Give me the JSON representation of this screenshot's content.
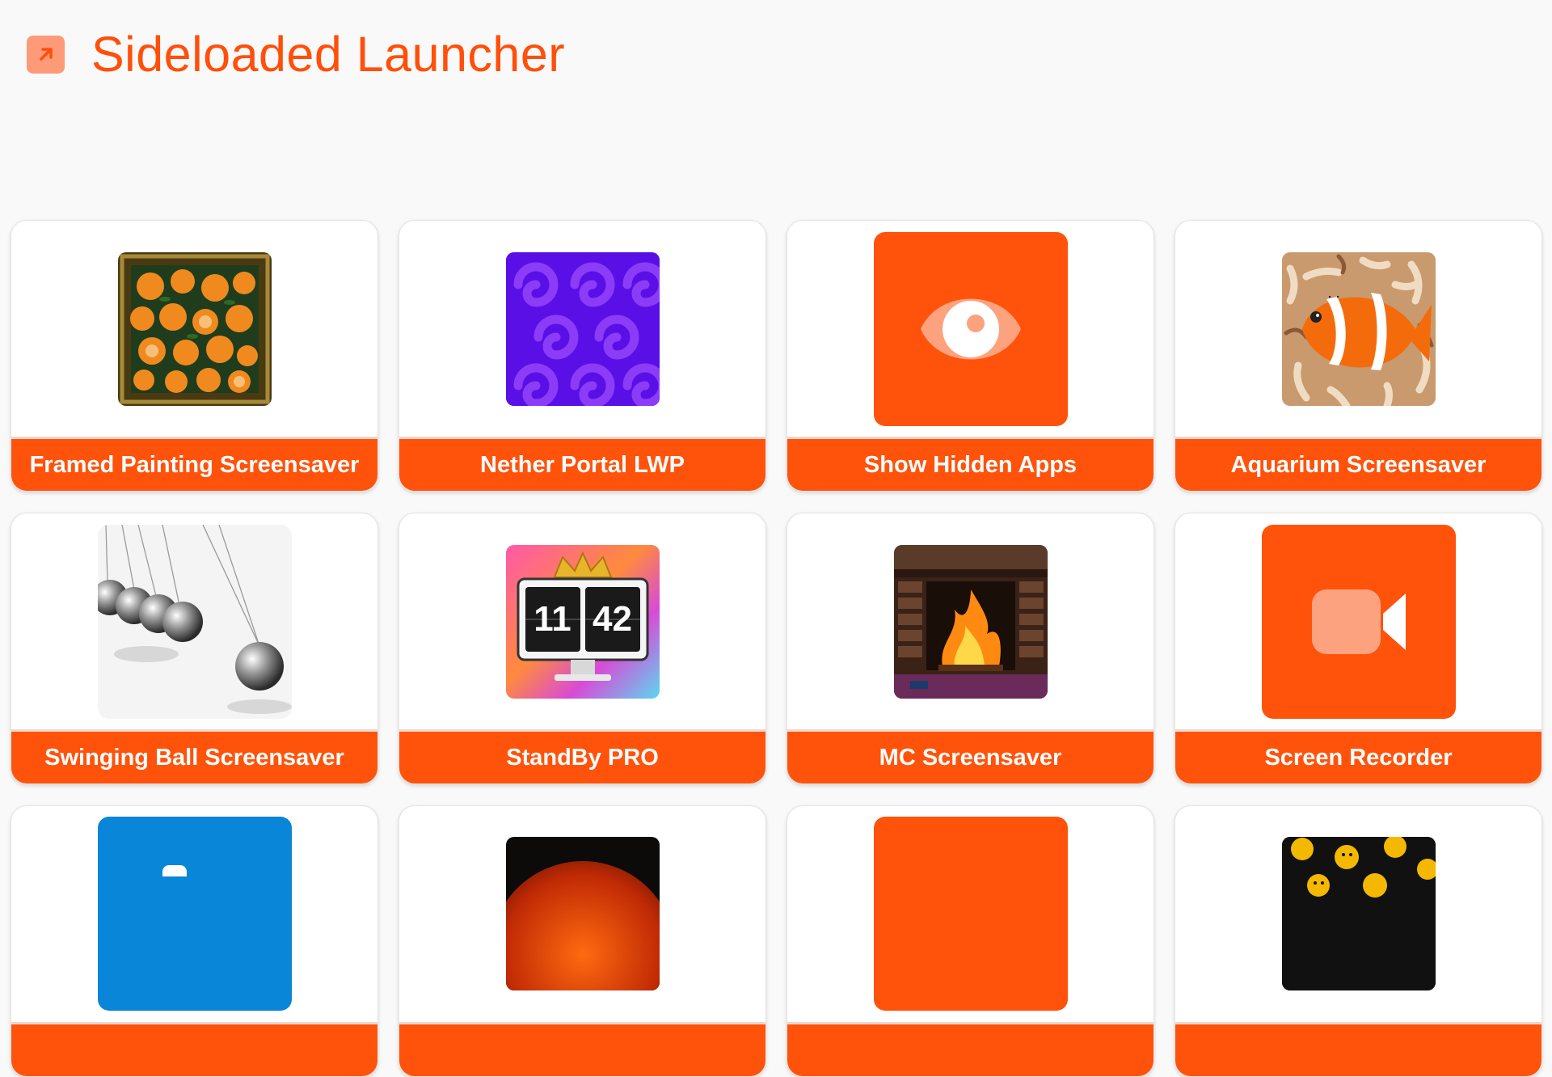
{
  "header": {
    "title": "Sideloaded Launcher",
    "logo_icon": "external-arrow-icon"
  },
  "colors": {
    "accent": "#ff530b",
    "accent_light": "#fda27f",
    "background": "#f9f9f9"
  },
  "apps": [
    {
      "label": "Framed Painting Screensaver",
      "icon": "framed-oranges-painting-icon"
    },
    {
      "label": "Nether Portal LWP",
      "icon": "purple-swirl-portal-icon"
    },
    {
      "label": "Show Hidden Apps",
      "icon": "eye-icon"
    },
    {
      "label": "Aquarium Screensaver",
      "icon": "clownfish-icon"
    },
    {
      "label": "Swinging Ball Screensaver",
      "icon": "newtons-cradle-icon"
    },
    {
      "label": "StandBy PRO",
      "icon": "flip-clock-crown-icon",
      "clock_hours": "11",
      "clock_minutes": "42"
    },
    {
      "label": "MC Screensaver",
      "icon": "fireplace-icon"
    },
    {
      "label": "Screen Recorder",
      "icon": "video-camera-icon"
    },
    {
      "label": "",
      "icon": "blue-app-icon"
    },
    {
      "label": "",
      "icon": "sun-app-icon"
    },
    {
      "label": "",
      "icon": "orange-app-icon"
    },
    {
      "label": "",
      "icon": "emoji-app-icon"
    }
  ]
}
